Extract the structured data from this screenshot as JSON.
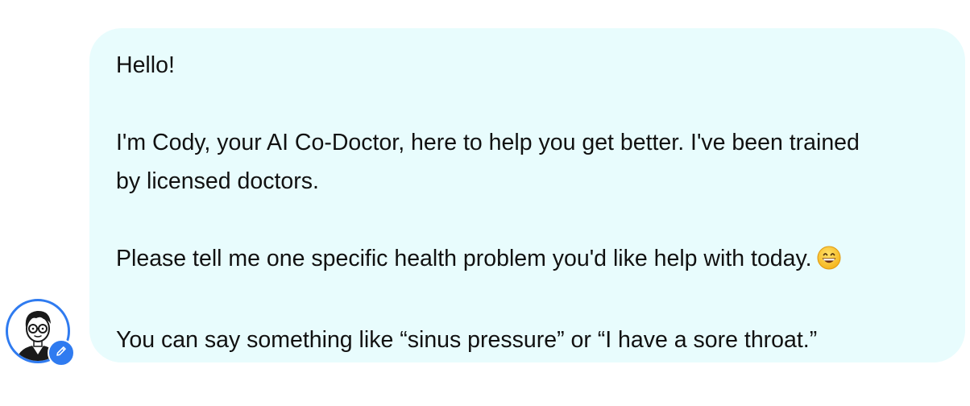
{
  "message": {
    "greeting": "Hello!",
    "intro_line1": "I'm Cody, your AI Co-Doctor, here to help you get better. I've been trained",
    "intro_line2": "by licensed doctors.",
    "request": "Please tell me one specific health problem you'd like help with today.",
    "request_emoji": "grinning-face-icon",
    "examples": "You can say something like “sinus pressure” or “I have a sore throat.”"
  },
  "avatar": {
    "icon": "doctor-avatar-icon",
    "badge_icon": "pencil-icon"
  },
  "colors": {
    "bubble_background": "#e8fcfd",
    "text": "#111111",
    "accent": "#2f7bf0"
  }
}
